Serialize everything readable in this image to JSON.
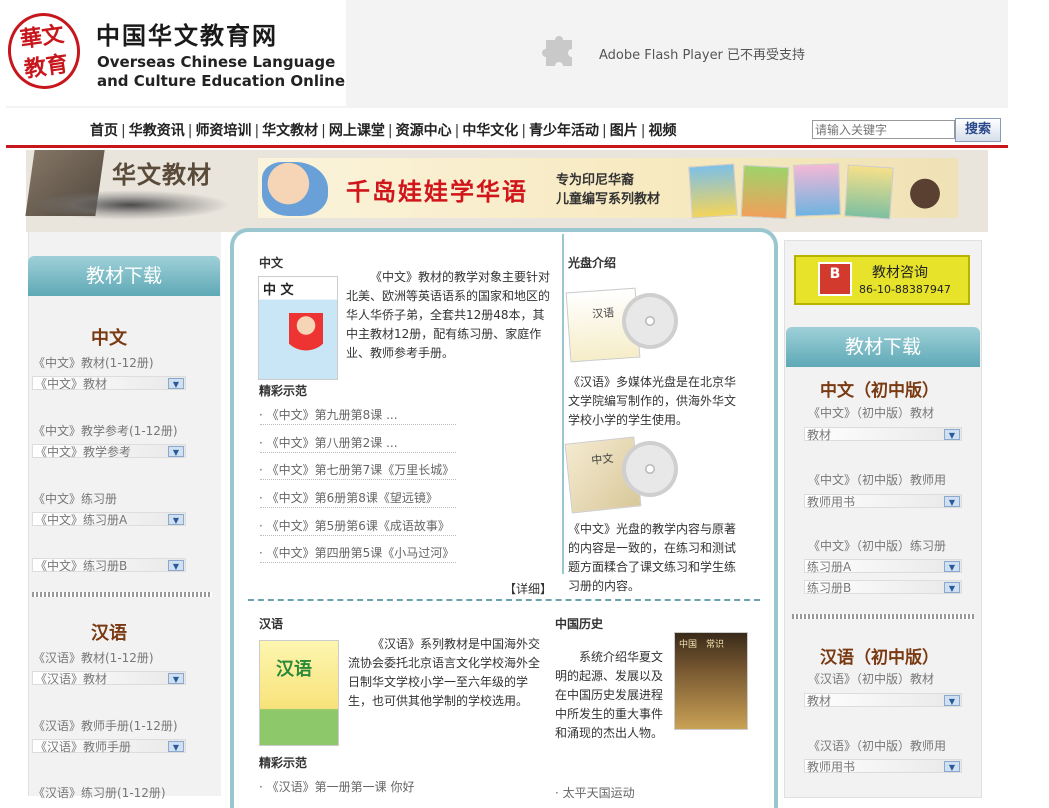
{
  "header": {
    "logo_seal": "華 文\n教 育",
    "logo_cn": "中国华文教育网",
    "logo_en_line1": "Overseas Chinese Language",
    "logo_en_line2": "and Culture Education Online",
    "flash_notice": "Adobe Flash Player 已不再受支持"
  },
  "nav": {
    "items": [
      "首页",
      "华教资讯",
      "师资培训",
      "华文教材",
      "网上课堂",
      "资源中心",
      "中华文化",
      "青少年活动",
      "图片",
      "视频"
    ],
    "separator": "|"
  },
  "search": {
    "placeholder": "请输入关键字",
    "button_label": "搜索"
  },
  "banner": {
    "section_title": "华文教材",
    "ad_title": "千岛娃娃学华语",
    "ad_sub1": "专为印尼华裔",
    "ad_sub2": "儿童编写系列教材"
  },
  "left": {
    "tab_title": "教材下载",
    "cat1": {
      "title": "中文",
      "groups": [
        {
          "label": "《中文》教材(1-12册)",
          "rows": [
            "《中文》教材"
          ]
        },
        {
          "label": "《中文》教学参考(1-12册)",
          "rows": [
            "《中文》教学参考"
          ]
        },
        {
          "label": "《中文》练习册",
          "rows": [
            "《中文》练习册A",
            "《中文》练习册B"
          ]
        }
      ]
    },
    "cat2": {
      "title": "汉语",
      "groups": [
        {
          "label": "《汉语》教材(1-12册)",
          "rows": [
            "《汉语》教材"
          ]
        },
        {
          "label": "《汉语》教师手册(1-12册)",
          "rows": [
            "《汉语》教师手册"
          ]
        },
        {
          "label": "《汉语》练习册(1-12册)",
          "rows": []
        }
      ]
    },
    "download_icon": "download-icon"
  },
  "middle": {
    "zhongwen": {
      "heading": "中文",
      "cover_title": "中 文",
      "description": "《中文》教材的教学对象主要针对北美、欧洲等英语语系的国家和地区的华人华侨子弟，全套共12册48本，其中主教材12册，配有练习册、家庭作业、教师参考手册。",
      "samples_heading": "精彩示范",
      "samples": [
        "《中文》第九册第8课 ...",
        "《中文》第八册第2课 ...",
        "《中文》第七册第7课《万里长城》",
        "《中文》第6册第8课《望远镜》",
        "《中文》第5册第6课《成语故事》",
        "《中文》第四册第5课《小马过河》"
      ],
      "more": "【详细】"
    },
    "disc": {
      "heading": "光盘介绍",
      "desc1": "《汉语》多媒体光盘是在北京华文学院编写制作的，供海外华文学校小学的学生使用。",
      "desc2": "《中文》光盘的教学内容与原著的内容是一致的，在练习和测试题方面糅合了课文练习和学生练习册的内容。",
      "cd1_label": "汉语",
      "cd2_label": "中文"
    },
    "hanyu": {
      "heading": "汉语",
      "cover_title": "汉语",
      "description": "《汉语》系列教材是中国海外交流协会委托北京语言文化学校海外全日制华文学校小学一至六年级的学生，也可供其他学制的学校选用。",
      "samples_heading": "精彩示范",
      "samples": [
        "《汉语》第一册第一课 你好"
      ]
    },
    "history": {
      "heading": "中国历史",
      "cover_title": "中国　常识",
      "description": "系统介绍华夏文明的起源、发展以及在中国历史发展进程中所发生的重大事件和涌现的杰出人物。",
      "samples": [
        "太平天国运动"
      ]
    }
  },
  "right": {
    "consult_title": "教材咨询",
    "consult_phone": "86-10-88387947",
    "consult_icon_letter": "B",
    "tab_title": "教材下载",
    "cat1": {
      "title": "中文（初中版）",
      "groups": [
        {
          "label": "《中文》（初中版）教材",
          "rows": [
            "教材"
          ]
        },
        {
          "label": "《中文》（初中版）教师用",
          "rows": [
            "教师用书"
          ]
        },
        {
          "label": "《中文》（初中版）练习册",
          "rows": [
            "练习册A",
            "练习册B"
          ]
        }
      ]
    },
    "cat2": {
      "title": "汉语（初中版）",
      "groups": [
        {
          "label": "《汉语》（初中版）教材",
          "rows": [
            "教材"
          ]
        },
        {
          "label": "《汉语》（初中版）教师用",
          "rows": [
            "教师用书"
          ]
        }
      ]
    }
  },
  "colors": {
    "brand_red": "#c8161d",
    "teal": "#5ea9b6",
    "category_brown": "#7a3a12",
    "consult_yellow": "#e6e32a"
  }
}
